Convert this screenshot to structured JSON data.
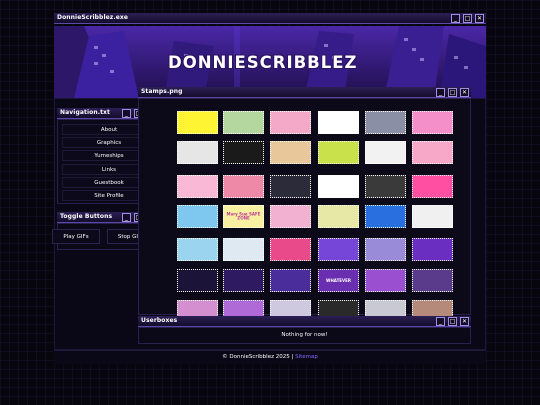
{
  "main_window": {
    "title": "DonnieScribblez.exe",
    "banner_text": "DONNIESCRIBBLEZ",
    "buttons": [
      "_",
      "□",
      "✕"
    ]
  },
  "navigation": {
    "title": "Navigation.txt",
    "items": [
      "About",
      "Graphics",
      "Yumeships",
      "Links",
      "Guestbook",
      "Site Profile"
    ]
  },
  "toggle": {
    "title": "Toggle Buttons",
    "play": "Play GIFs",
    "stop": "Stop GIFs"
  },
  "stamps": {
    "title": "Stamps.png",
    "items": [
      {
        "text": "",
        "color": "#fff433"
      },
      {
        "text": "",
        "color": "#b4d7a0"
      },
      {
        "text": "",
        "color": "#f4a9c9"
      },
      {
        "text": "",
        "color": "#ffffff"
      },
      {
        "text": "",
        "color": "#8a8fa5"
      },
      {
        "text": "",
        "color": "#f58fc9"
      },
      {
        "text": "",
        "color": "#e6e6e6"
      },
      {
        "text": "",
        "color": "#1a1a1a"
      },
      {
        "text": "",
        "color": "#e8c89a"
      },
      {
        "text": "",
        "color": "#c9e14a"
      },
      {
        "text": "",
        "color": "#f2f2f2"
      },
      {
        "text": "",
        "color": "#f7a8c8"
      },
      {
        "text": "",
        "color": "#f9b8d6"
      },
      {
        "text": "",
        "color": "#ee8aa8"
      },
      {
        "text": "",
        "color": "#2b2b3a"
      },
      {
        "text": "",
        "color": "#ffffff"
      },
      {
        "text": "",
        "color": "#3a3a3a"
      },
      {
        "text": "",
        "color": "#ff4fa3"
      },
      {
        "text": "",
        "color": "#7ec8f0"
      },
      {
        "text": "Mary Sue SAFE ZONE",
        "color": "#f6f0a0"
      },
      {
        "text": "",
        "color": "#f3b1d2"
      },
      {
        "text": "",
        "color": "#e7e7a6"
      },
      {
        "text": "",
        "color": "#2a6fe0"
      },
      {
        "text": "",
        "color": "#f0f0f0"
      },
      {
        "text": "",
        "color": "#9ad4ee"
      },
      {
        "text": "",
        "color": "#dfe9f2"
      },
      {
        "text": "",
        "color": "#e94a8a"
      },
      {
        "text": "",
        "color": "#7646d8"
      },
      {
        "text": "",
        "color": "#9a8bd8"
      },
      {
        "text": "",
        "color": "#6a2fc0"
      },
      {
        "text": "",
        "color": "#1c1438"
      },
      {
        "text": "",
        "color": "#2e1a60"
      },
      {
        "text": "",
        "color": "#4a2d9a"
      },
      {
        "text": "WHATEVER",
        "color": "#6a2fb0"
      },
      {
        "text": "",
        "color": "#9a4fd0"
      },
      {
        "text": "",
        "color": "#5a3a8a"
      },
      {
        "text": "",
        "color": "#d48fd0"
      },
      {
        "text": "",
        "color": "#b06ad8"
      },
      {
        "text": "",
        "color": "#cfc9e0"
      },
      {
        "text": "",
        "color": "#2a2a2a"
      },
      {
        "text": "",
        "color": "#c9c9d4"
      },
      {
        "text": "",
        "color": "#b58a7a"
      }
    ]
  },
  "userboxes": {
    "title": "Userboxes",
    "empty": "Nothing for now!"
  },
  "footer": {
    "copyright": "© DonnieScribblez 2025 |",
    "sitemap": "Sitemap"
  }
}
